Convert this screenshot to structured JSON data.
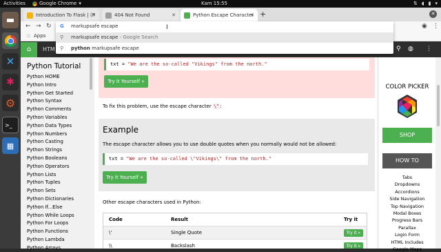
{
  "system_bar": {
    "activities": "Activities",
    "app_name": "Google Chrome",
    "clock": "Kam 15:55"
  },
  "browser": {
    "tabs": [
      {
        "title": "Introduction To Flask | (P",
        "active": false,
        "favicon_color": "#f4b400"
      },
      {
        "title": "404 Not Found",
        "active": false,
        "favicon_color": "#9e9e9e"
      },
      {
        "title": "Python Escape Character",
        "active": true,
        "favicon_color": "#4caf50"
      }
    ],
    "new_tab": "+",
    "address_value": "markupsafe escape",
    "suggestions": [
      {
        "icon": "search-icon",
        "query": "markupsafe escape",
        "suffix": " - Google Search"
      },
      {
        "icon": "search-icon",
        "prefix": "python ",
        "query": "markupsafe escape",
        "suffix": ""
      }
    ],
    "bookmarks": {
      "apps_label": "Apps"
    }
  },
  "site_nav": {
    "partial_label": "HTM"
  },
  "sidebar": {
    "title": "Python Tutorial",
    "items": [
      "Python HOME",
      "Python Intro",
      "Python Get Started",
      "Python Syntax",
      "Python Comments",
      "Python Variables",
      "Python Data Types",
      "Python Numbers",
      "Python Casting",
      "Python Strings",
      "Python Booleans",
      "Python Operators",
      "Python Lists",
      "Python Tuples",
      "Python Sets",
      "Python Dictionaries",
      "Python If...Else",
      "Python While Loops",
      "Python For Loops",
      "Python Functions",
      "Python Lambda",
      "Python Arrays"
    ]
  },
  "content": {
    "code1": {
      "var": "txt = ",
      "str": "\"We are the so-called \"Vikings\" from the north.\""
    },
    "try_label": "Try it Yourself »",
    "fix_text_pre": "To fix this problem, use the escape character ",
    "fix_code": "\\\"",
    "fix_text_post": ":",
    "example_heading": "Example",
    "example_desc": "The escape character allows you to use double quotes when you normally would not be allowed:",
    "code2": {
      "var": "txt = ",
      "str": "\"We are the so-called \\\"Vikings\\\" from the north.\""
    },
    "other_text": "Other escape characters used in Python:",
    "table": {
      "headers": [
        "Code",
        "Result",
        "Try it"
      ],
      "rows": [
        {
          "code": "\\'",
          "result": "Single Quote",
          "btn": "Try it »"
        },
        {
          "code": "\\\\",
          "result": "Backslash",
          "btn": "Try it »"
        }
      ]
    }
  },
  "right_col": {
    "color_picker": "COLOR PICKER",
    "shop": "SHOP",
    "howto": "HOW TO",
    "howto_links": [
      "Tabs",
      "Dropdowns",
      "Accordions",
      "Side Navigation",
      "Top Navigation",
      "Modal Boxes",
      "Progress Bars",
      "Parallax",
      "Login Form",
      "HTML Includes",
      "Google Maps"
    ]
  },
  "colors": {
    "accent_green": "#4caf50",
    "dock_bg": "#3b3b3b",
    "nav_bg": "#2e2e2e"
  }
}
